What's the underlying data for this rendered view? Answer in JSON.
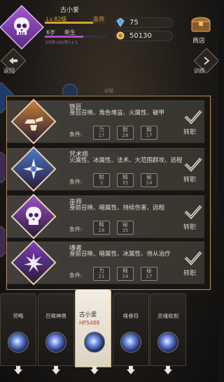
{
  "player": {
    "name": "古小爱",
    "level": "Lv.82级",
    "rank": "巫师",
    "xp_fraction": 0.78,
    "age": "6岁",
    "stage": "新生",
    "life_fraction": 0.62,
    "life_text": "39年/40年(+1"
  },
  "currency": {
    "gems": "75",
    "gold": "50130"
  },
  "shop_label": "商店",
  "back_label": "返回",
  "train_label": "训练",
  "background_label": "冰赋",
  "professions": [
    {
      "name": "铁匠",
      "description": "身后召唤、角色增益、火属性、破甲",
      "condition_label": "条件:",
      "requirements": [
        {
          "stat": "力",
          "value": "17"
        },
        {
          "stat": "耐",
          "value": "28"
        },
        {
          "stat": "精",
          "value": "17"
        }
      ],
      "action_label": "转职",
      "color": "#c5813a"
    },
    {
      "name": "咒术师",
      "description": "火属性、冰属性、法术、大范围群攻、远程",
      "condition_label": "条件:",
      "requirements": [
        {
          "stat": "耐",
          "value": "3"
        },
        {
          "stat": "精",
          "value": "35"
        },
        {
          "stat": "秘",
          "value": "24"
        }
      ],
      "action_label": "转职",
      "color": "#4d78c9"
    },
    {
      "name": "巫师",
      "description": "身前召唤、暗属性、持续伤害、远程",
      "condition_label": "条件:",
      "requirements": [
        {
          "stat": "精",
          "value": "28"
        },
        {
          "stat": "秘",
          "value": "35"
        }
      ],
      "action_label": "转职",
      "color": "#9c4fd0"
    },
    {
      "name": "魂者",
      "description": "身前召唤、暗属性、冰属性、侍从治疗",
      "condition_label": "条件:",
      "requirements": [
        {
          "stat": "力",
          "value": "21"
        },
        {
          "stat": "精",
          "value": "24"
        },
        {
          "stat": "秘",
          "value": "17"
        }
      ],
      "action_label": "转职",
      "color": "#7a3fbb"
    }
  ],
  "cards": [
    {
      "label": "劳略"
    },
    {
      "label": "召唤神兽"
    },
    {
      "label": "古小爱",
      "hp": "HP5488",
      "selected": true
    },
    {
      "label": "唤骨符"
    },
    {
      "label": "灵魂收割"
    }
  ]
}
